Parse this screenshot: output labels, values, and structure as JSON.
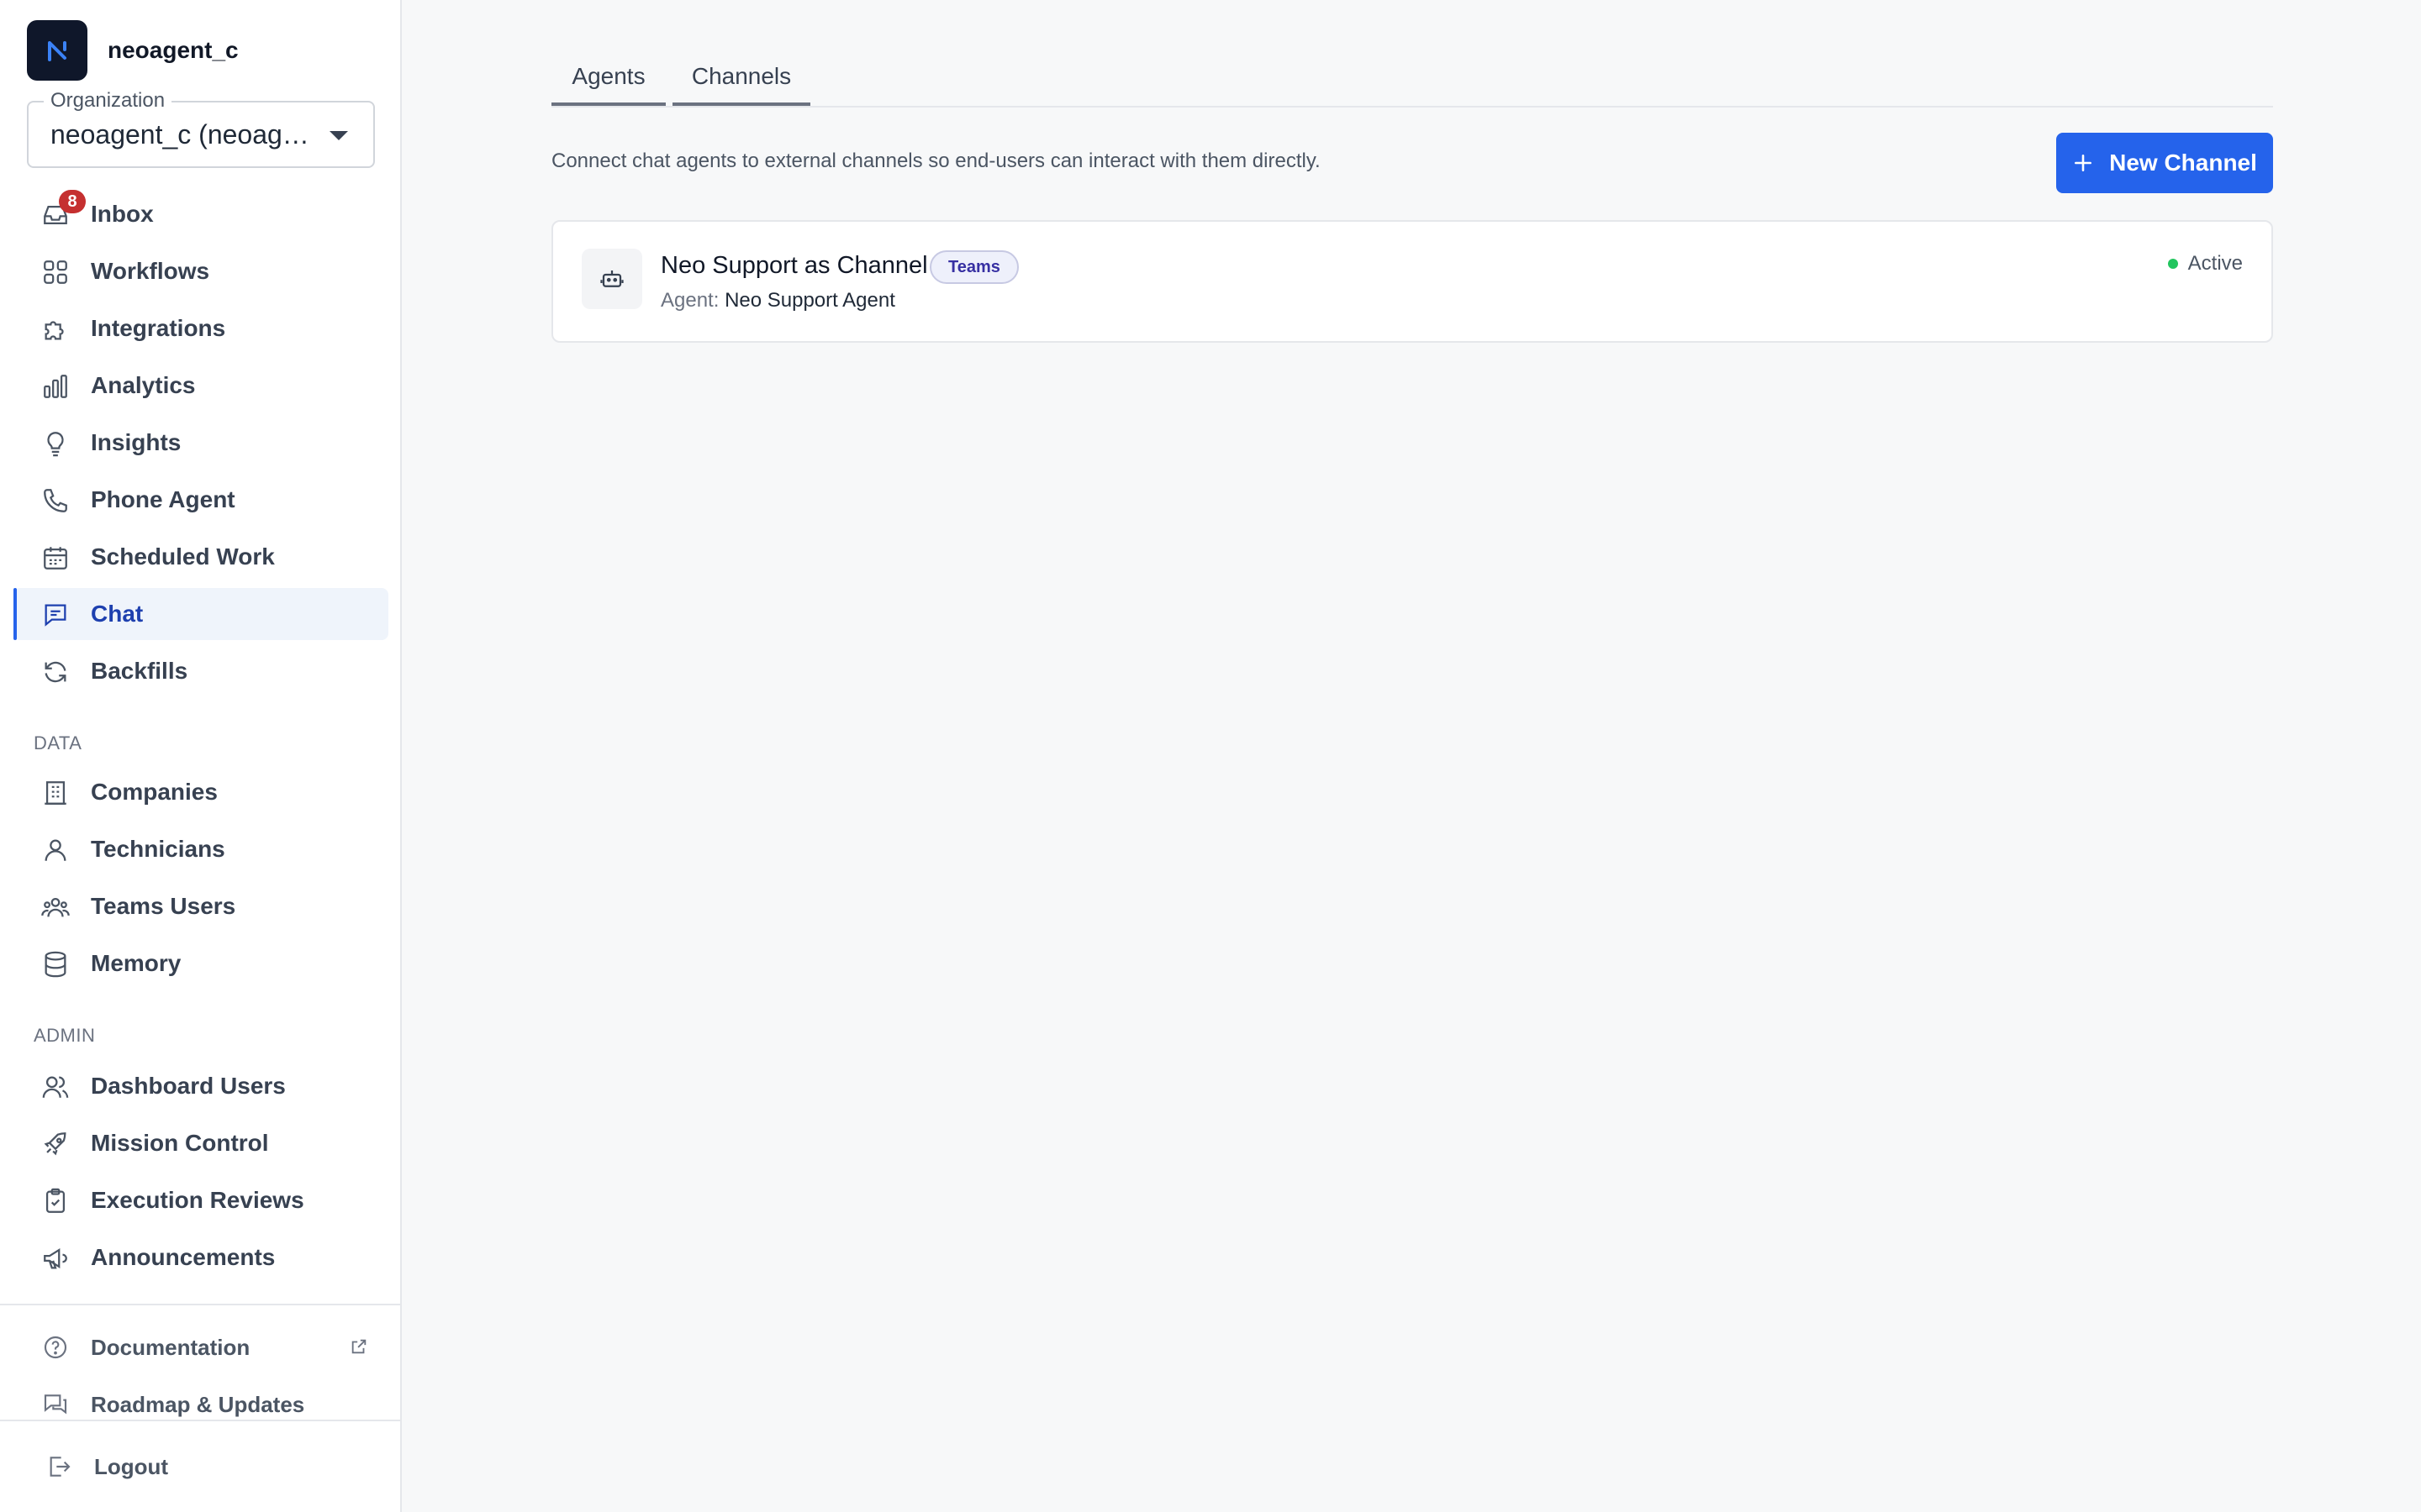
{
  "sidebar": {
    "brand_name": "neoagent_c",
    "organization_label": "Organization",
    "organization_value": "neoagent_c (neoagent_c)",
    "inbox_badge": "8",
    "items": [
      {
        "label": "Inbox"
      },
      {
        "label": "Workflows"
      },
      {
        "label": "Integrations"
      },
      {
        "label": "Analytics"
      },
      {
        "label": "Insights"
      },
      {
        "label": "Phone Agent"
      },
      {
        "label": "Scheduled Work"
      },
      {
        "label": "Chat"
      },
      {
        "label": "Backfills"
      }
    ],
    "data_section_label": "DATA",
    "data_items": [
      {
        "label": "Companies"
      },
      {
        "label": "Technicians"
      },
      {
        "label": "Teams Users"
      },
      {
        "label": "Memory"
      }
    ],
    "admin_section_label": "ADMIN",
    "admin_items": [
      {
        "label": "Dashboard Users"
      },
      {
        "label": "Mission Control"
      },
      {
        "label": "Execution Reviews"
      },
      {
        "label": "Announcements"
      }
    ],
    "footer": {
      "documentation": "Documentation",
      "roadmap": "Roadmap & Updates",
      "logout": "Logout"
    }
  },
  "main": {
    "tabs": [
      {
        "label": "Agents"
      },
      {
        "label": "Channels"
      }
    ],
    "description": "Connect chat agents to external channels so end-users can interact with them directly.",
    "new_channel_button": "New Channel",
    "channels": [
      {
        "title": "Neo Support as Channel",
        "badge": "Teams",
        "agent_prefix": "Agent:",
        "agent_name": "Neo Support Agent",
        "status": "Active"
      }
    ]
  },
  "colors": {
    "accent": "#2563eb",
    "active_nav_bg": "#eff4fb",
    "status_active": "#22c55e",
    "badge_red": "#c53030"
  }
}
